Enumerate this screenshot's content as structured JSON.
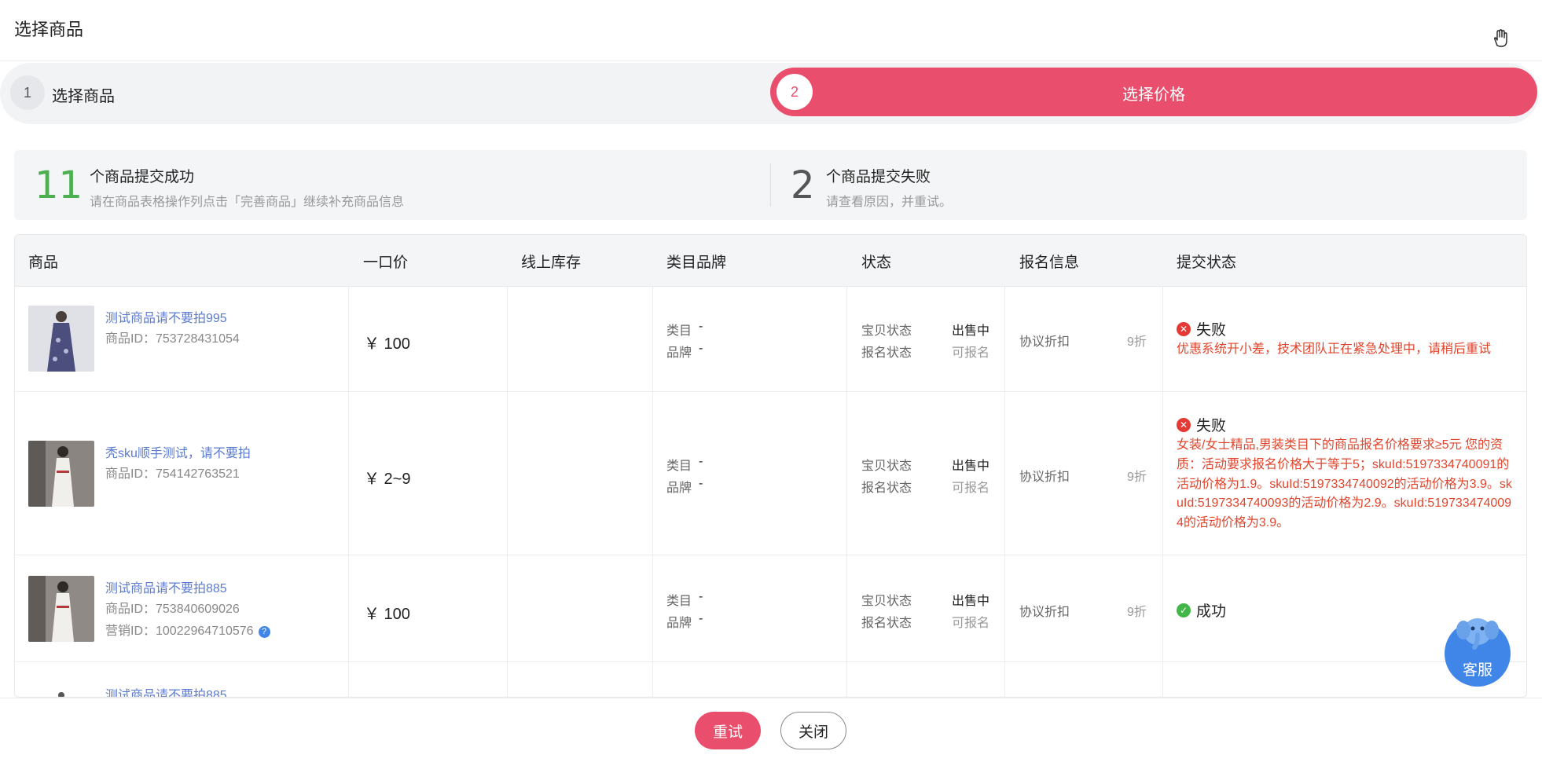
{
  "header": {
    "title": "选择商品"
  },
  "steps": [
    {
      "num": "1",
      "label": "选择商品"
    },
    {
      "num": "2",
      "label": "选择价格"
    }
  ],
  "summary": {
    "success_count": "11",
    "success_title": "个商品提交成功",
    "success_sub": "请在商品表格操作列点击「完善商品」继续补充商品信息",
    "fail_count": "2",
    "fail_title": "个商品提交失败",
    "fail_sub": "请查看原因，并重试。"
  },
  "table": {
    "headers": [
      "商品",
      "一口价",
      "线上库存",
      "类目品牌",
      "状态",
      "报名信息",
      "提交状态"
    ],
    "labels": {
      "category": "类目",
      "brand": "品牌",
      "item_status": "宝贝状态",
      "signup_status": "报名状态",
      "signup_info": "协议折扣"
    },
    "rows": [
      {
        "name": "测试商品请不要拍995",
        "id": "商品ID：753728431054",
        "price": "￥ 100",
        "category": "-",
        "brand": "-",
        "item_status": "出售中",
        "signup_status": "可报名",
        "discount": "9折",
        "submit_status": "失败",
        "error": "优惠系统开小差，技术团队正在紧急处理中，请稍后重试"
      },
      {
        "name": "秃sku顺手测试，请不要拍",
        "id": "商品ID：754142763521",
        "price": "￥ 2~9",
        "category": "-",
        "brand": "-",
        "item_status": "出售中",
        "signup_status": "可报名",
        "discount": "9折",
        "submit_status": "失败",
        "error": "女装/女士精品,男装类目下的商品报名价格要求≥5元 您的资质：活动要求报名价格大于等于5；skuId:5197334740091的活动价格为1.9。skuId:5197334740092的活动价格为3.9。skuId:5197334740093的活动价格为2.9。skuId:5197334740094的活动价格为3.9。"
      },
      {
        "name": "测试商品请不要拍885",
        "id": "商品ID：753840609026",
        "marketing_id": "营销ID：10022964710576",
        "price": "￥ 100",
        "category": "-",
        "brand": "-",
        "item_status": "出售中",
        "signup_status": "可报名",
        "discount": "9折",
        "submit_status": "成功"
      },
      {
        "name": "测试商品请不要拍885"
      }
    ]
  },
  "footer": {
    "retry_label": "重试",
    "close_label": "关闭"
  },
  "service": {
    "label": "客服"
  },
  "colors": {
    "accent": "#e94f6c",
    "success": "#4caf50",
    "error": "#e53935",
    "link": "#5b7bd0"
  }
}
